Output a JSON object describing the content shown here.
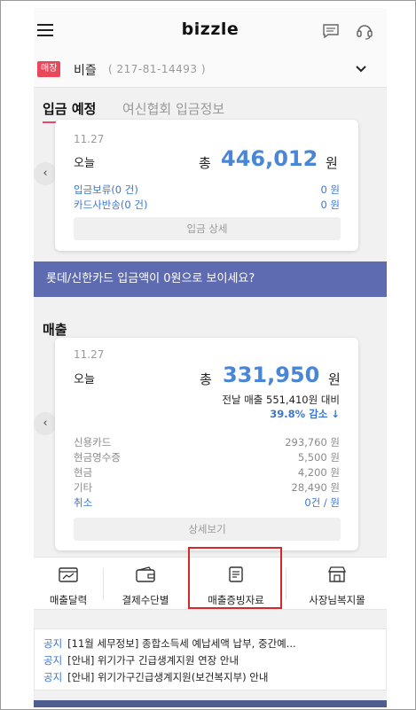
{
  "header": {
    "logo": "bizzle",
    "icons": [
      "menu-icon",
      "chat-icon",
      "headset-icon"
    ]
  },
  "store": {
    "badge": "매장",
    "name": "비즐",
    "biz_number": "( 217-81-14493 )"
  },
  "tabs": [
    {
      "label": "입금 예정",
      "active": true
    },
    {
      "label": "여신협회 입금정보",
      "active": false
    }
  ],
  "deposit_card": {
    "date": "11.27",
    "today_label": "오늘",
    "total_prefix": "총",
    "total": "446,012",
    "unit": "원",
    "rows": [
      {
        "label": "입금보류(0 건)",
        "value": "0 원"
      },
      {
        "label": "카드사반송(0 건)",
        "value": "0 원"
      }
    ],
    "button": "입금 상세"
  },
  "banner": {
    "text": "롯데/신한카드 입금액이 0원으로 보이세요?"
  },
  "sales": {
    "section_title": "매출",
    "date": "11.27",
    "today_label": "오늘",
    "total_prefix": "총",
    "total": "331,950",
    "unit": "원",
    "compare_text": "전날 매출 551,410원 대비",
    "compare_change": "39.8% 감소 ↓",
    "rows": [
      {
        "label": "신용카드",
        "value": "293,760 원"
      },
      {
        "label": "현금영수증",
        "value": "5,500 원"
      },
      {
        "label": "현금",
        "value": "4,200 원"
      },
      {
        "label": "기타",
        "value": "28,490 원"
      },
      {
        "label": "취소",
        "value": "0건 / 원"
      }
    ],
    "button": "상세보기"
  },
  "shortcuts": [
    {
      "label": "매출달력",
      "icon": "calendar-chart-icon"
    },
    {
      "label": "결제수단별",
      "icon": "wallet-icon"
    },
    {
      "label": "매출증빙자료",
      "icon": "document-icon"
    },
    {
      "label": "사장님복지몰",
      "icon": "shop-icon"
    }
  ],
  "notices": [
    {
      "tag": "공지",
      "text": "[11월 세무정보] 종합소득세 예납세액 납부, 중간예..."
    },
    {
      "tag": "공지",
      "text": "[안내] 위기가구 긴급생계지원 연장 안내"
    },
    {
      "tag": "공지",
      "text": "[안내] 위기가구긴급생계지원(보건복지부) 안내"
    }
  ],
  "colors": {
    "accent_blue": "#4a86d8",
    "banner": "#5e6bb0",
    "badge": "#e9485a",
    "highlight": "#d62828"
  }
}
